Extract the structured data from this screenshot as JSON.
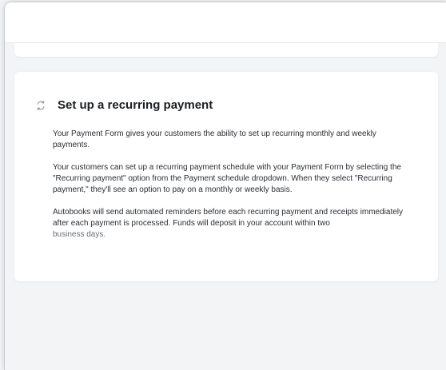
{
  "section": {
    "icon": "recurring-icon",
    "title": "Set up a recurring payment",
    "paragraphs": [
      "Your Payment Form gives your customers the ability to set up recurring monthly and weekly payments.",
      "Your customers can set up a recurring payment schedule with your Payment Form by selecting the \"Recurring payment\" option from the Payment schedule dropdown. When they select \"Recurring payment,\" they'll see an option to pay on a monthly or weekly basis.",
      "Autobooks will send automated reminders before each recurring payment and receipts immediately after each payment is processed. Funds will deposit in your account within two"
    ],
    "paragraph_tail": "business days."
  }
}
